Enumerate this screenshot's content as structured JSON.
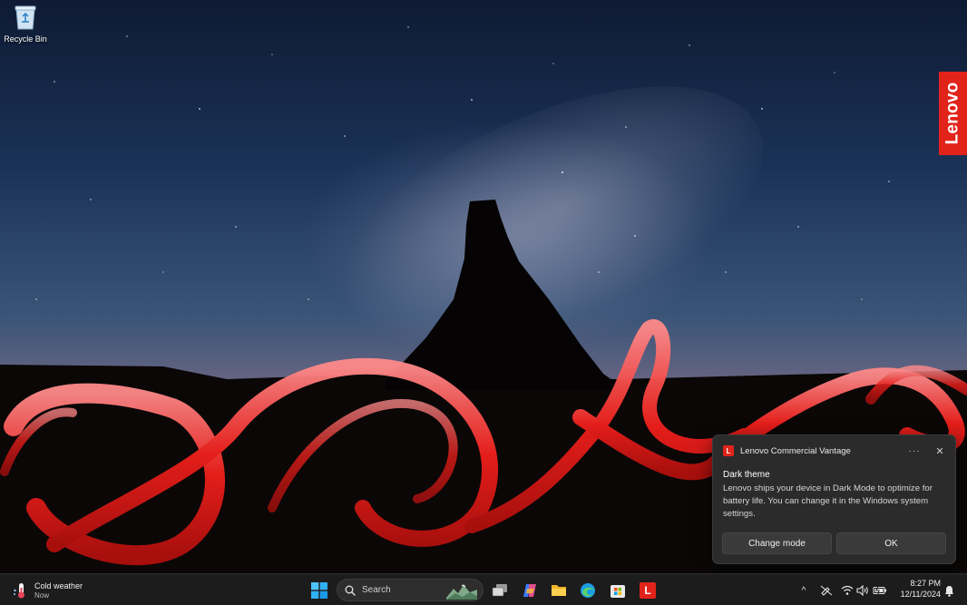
{
  "desktop": {
    "icons": [
      {
        "label": "Recycle Bin",
        "icon": "recycle-bin-icon"
      }
    ]
  },
  "brand_tab": {
    "label": "Lenovo",
    "color": "#e2231a"
  },
  "notification": {
    "app_name": "Lenovo Commercial Vantage",
    "app_icon_letter": "L",
    "more_label": "···",
    "close_label": "✕",
    "title": "Dark theme",
    "body": "Lenovo ships your device in Dark Mode to optimize for battery life. You can change it in the Windows system settings.",
    "buttons": {
      "change_mode": "Change mode",
      "ok": "OK"
    }
  },
  "taskbar": {
    "weather": {
      "title": "Cold weather",
      "subtitle": "Now"
    },
    "search": {
      "placeholder": "Search"
    },
    "pinned_apps": [
      "start-icon",
      "search",
      "task-view-icon",
      "copilot-icon",
      "file-explorer-icon",
      "edge-icon",
      "store-icon",
      "lenovo-vantage-icon"
    ],
    "lenovo_letter": "L",
    "tray": {
      "overflow": "^",
      "icons": [
        "pen-off-icon",
        "wifi-icon",
        "volume-icon",
        "battery-icon"
      ]
    },
    "clock": {
      "time": "8:27 PM",
      "date": "12/11/2024"
    }
  }
}
